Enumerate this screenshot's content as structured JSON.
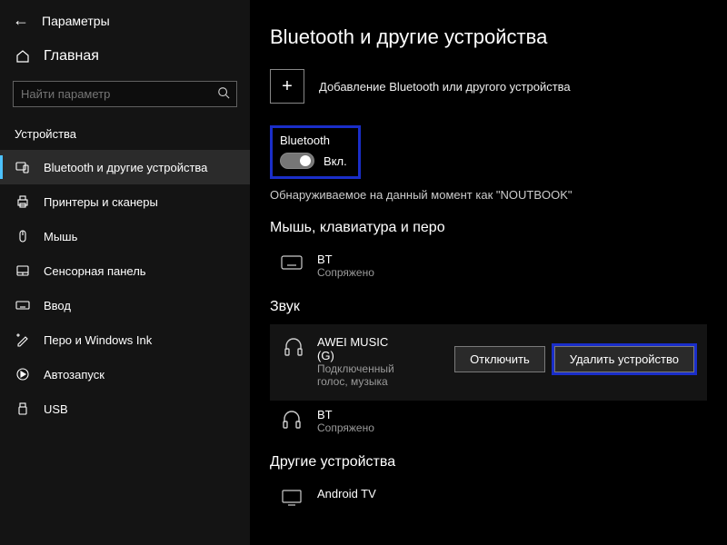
{
  "header": {
    "title": "Параметры"
  },
  "sidebar": {
    "home": "Главная",
    "search_placeholder": "Найти параметр",
    "section": "Устройства",
    "items": [
      {
        "label": "Bluetooth и другие устройства"
      },
      {
        "label": "Принтеры и сканеры"
      },
      {
        "label": "Мышь"
      },
      {
        "label": "Сенсорная панель"
      },
      {
        "label": "Ввод"
      },
      {
        "label": "Перо и Windows Ink"
      },
      {
        "label": "Автозапуск"
      },
      {
        "label": "USB"
      }
    ]
  },
  "main": {
    "title": "Bluetooth и другие устройства",
    "add_label": "Добавление Bluetooth или другого устройства",
    "bluetooth": {
      "label": "Bluetooth",
      "state": "Вкл."
    },
    "discoverable": "Обнаруживаемое на данный момент как \"NOUTBOOK\"",
    "sections": {
      "mouse_kb": "Мышь, клавиатура и перо",
      "audio": "Звук",
      "other": "Другие устройства"
    },
    "devices": {
      "bt_kb": {
        "name": "BT",
        "status": "Сопряжено"
      },
      "awei": {
        "name": "AWEI MUSIC (G)",
        "status": "Подключенный голос, музыка"
      },
      "bt_audio": {
        "name": "BT",
        "status": "Сопряжено"
      },
      "android": {
        "name": "Android TV"
      }
    },
    "buttons": {
      "disconnect": "Отключить",
      "remove": "Удалить устройство"
    }
  }
}
